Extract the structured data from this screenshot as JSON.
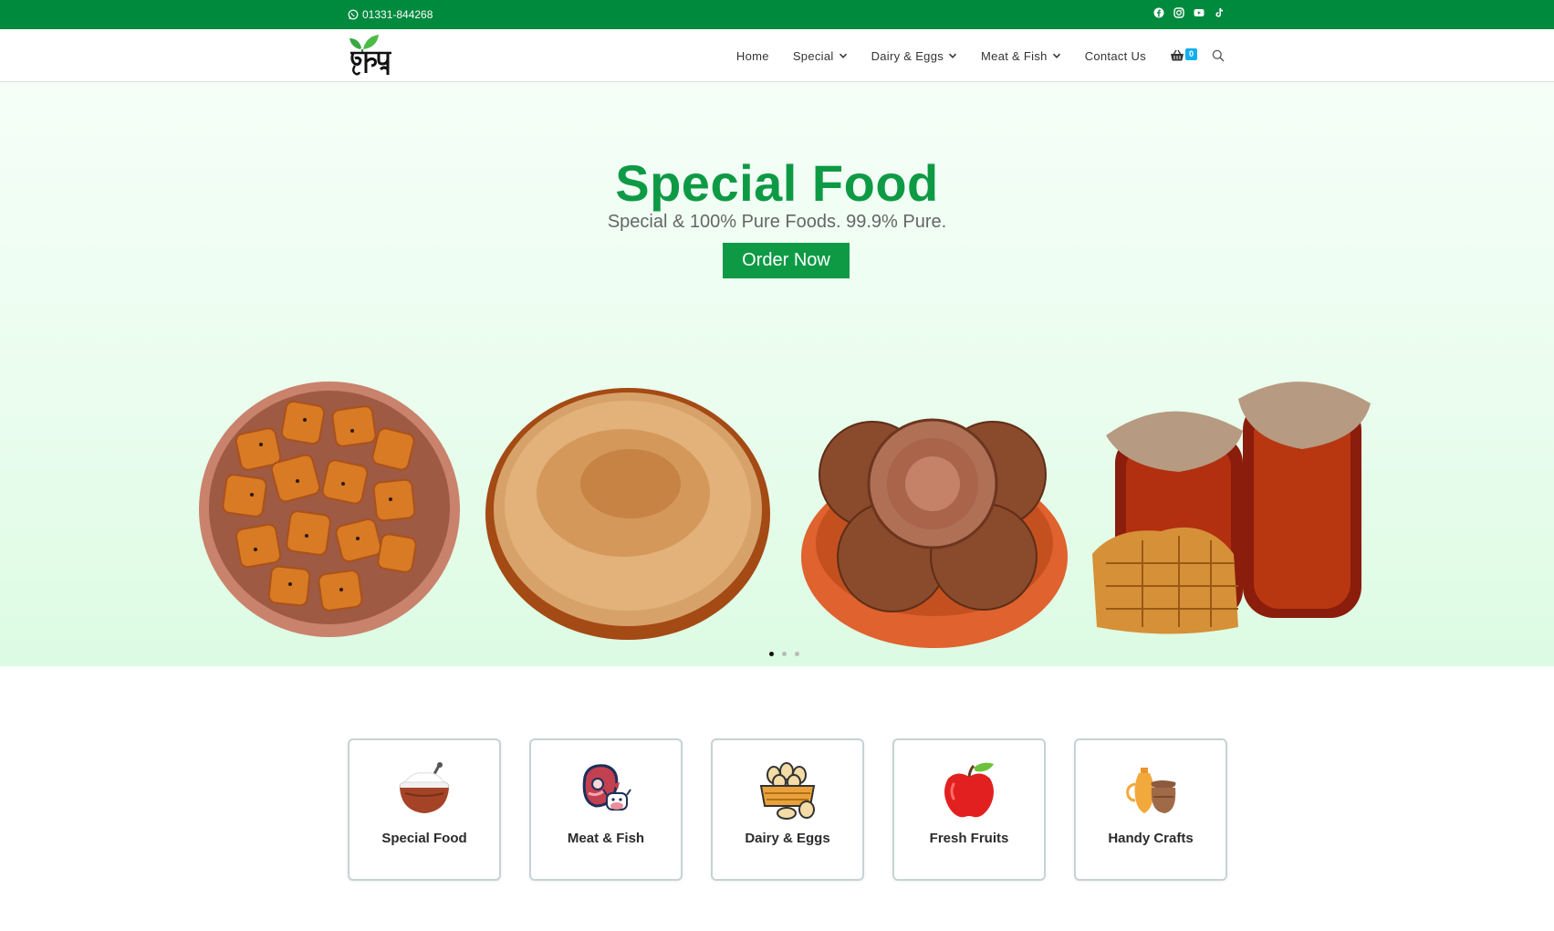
{
  "topbar": {
    "phone": "01331-844268",
    "socials": [
      "facebook-icon",
      "instagram-icon",
      "youtube-icon",
      "tiktok-icon"
    ]
  },
  "header": {
    "logo_text": "গৃহস্থ",
    "nav": [
      {
        "label": "Home",
        "dropdown": false
      },
      {
        "label": "Special",
        "dropdown": true
      },
      {
        "label": "Dairy & Eggs",
        "dropdown": true
      },
      {
        "label": "Meat & Fish",
        "dropdown": true
      },
      {
        "label": "Contact Us",
        "dropdown": false
      }
    ],
    "cart_count": "0"
  },
  "hero": {
    "title": "Special Food",
    "subtitle": "Special & 100% Pure Foods. 99.9% Pure.",
    "button": "Order Now",
    "products": [
      "pitha-bowl",
      "date-molasses-plate",
      "jaggery-plate",
      "honey-jars"
    ],
    "slides": 3,
    "active_slide": 1
  },
  "categories": [
    {
      "label": "Special Food",
      "icon": "yogurt-bowl-icon"
    },
    {
      "label": "Meat & Fish",
      "icon": "meat-icon"
    },
    {
      "label": "Dairy & Eggs",
      "icon": "egg-basket-icon"
    },
    {
      "label": "Fresh Fruits",
      "icon": "apple-icon"
    },
    {
      "label": "Handy Crafts",
      "icon": "pottery-icon"
    }
  ],
  "colors": {
    "brand_green": "#008a3e",
    "hero_green": "#0e9a45",
    "cart_badge": "#13aff0"
  }
}
